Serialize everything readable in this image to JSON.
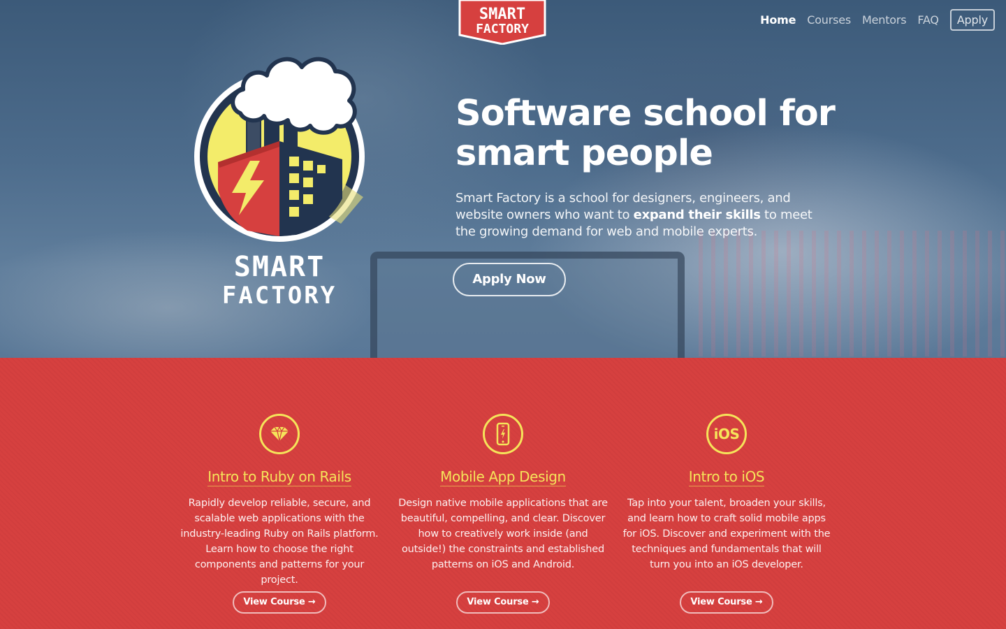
{
  "brand": {
    "tab_line1": "SMART",
    "tab_line2": "FACTORY",
    "logo_line1": "SMART",
    "logo_line2": "FACTORY"
  },
  "nav": {
    "items": [
      {
        "label": "Home",
        "active": true
      },
      {
        "label": "Courses",
        "active": false
      },
      {
        "label": "Mentors",
        "active": false
      },
      {
        "label": "FAQ",
        "active": false
      }
    ],
    "apply_label": "Apply"
  },
  "hero": {
    "headline": "Software school for smart people",
    "intro_before": "Smart Factory is a school for designers, engineers, and website owners who want to ",
    "intro_emphasis": "expand their skills",
    "intro_after": " to meet the growing demand for web and mobile experts.",
    "cta_label": "Apply Now"
  },
  "courses": [
    {
      "icon": "diamond-icon",
      "title": "Intro to Ruby on Rails",
      "description": "Rapidly develop reliable, secure, and scalable web applications with the industry-leading Ruby on Rails platform. Learn how to choose the right components and patterns for your project.",
      "button_label": "View Course →"
    },
    {
      "icon": "mobile-phone-icon",
      "title": "Mobile App Design",
      "description": "Design native mobile applications that are beautiful, compelling, and clear. Discover how to creatively work inside (and outside!) the constraints and established patterns on iOS and Android.",
      "button_label": "View Course →"
    },
    {
      "icon": "ios-icon",
      "icon_text": "iOS",
      "title": "Intro to iOS",
      "description": "Tap into your talent, broaden your skills, and learn how to craft solid mobile apps for iOS. Discover and experiment with the techniques and fundamentals that will turn you into an iOS developer.",
      "button_label": "View Course →"
    }
  ],
  "colors": {
    "brand_red": "#d6403f",
    "accent_yellow": "#f5e45a",
    "navy": "#22344f",
    "hero_blue": "#4d6c8c"
  }
}
